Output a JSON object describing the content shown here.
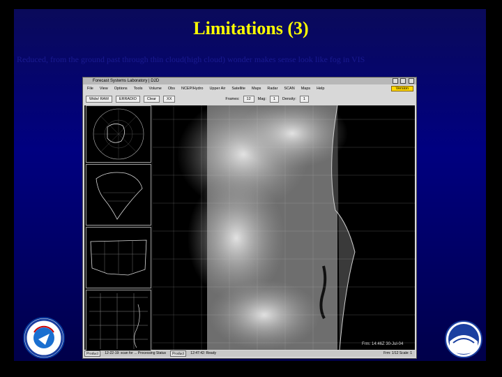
{
  "slide": {
    "title": "Limitations (3)",
    "subtitle": "Reduced, from the ground past through thin cloud(high cloud) wonder makes sense look like fog in VIS",
    "colors": {
      "background": "#000080",
      "title": "#ffff00"
    }
  },
  "app": {
    "window_title": "Forecast Systems Laboratory | D2D",
    "menu": [
      "File",
      "View",
      "Options",
      "Tools",
      "Volume",
      "Obs",
      "NCEP/Hydro",
      "Upper Air",
      "Satellite",
      "Maps",
      "Radar",
      "SCAN",
      "Maps",
      "Help"
    ],
    "version_label": "Version",
    "toolbar": {
      "map_select": "Wide/ RAM",
      "mode_select": "ERRADIO",
      "clear_label": "Clear",
      "frame_value": "XX",
      "frames_label": "Frames:",
      "frames_value": "12",
      "mag_label": "Mag:",
      "mag_value": "1",
      "density_label": "Density:",
      "density_value": "1"
    },
    "main_timestamp": "Frm: 14:46Z 30-Jul-04",
    "status": {
      "left_btn": "Product",
      "left_text": "12-22-19: scan for ... Processing Status",
      "mid_btn": "Product",
      "mid_text": "12:47:42: Ready",
      "right_text": "Frm: 1/12 Scale: 1"
    }
  },
  "logos": {
    "left": "NATIONAL WEATHER SERVICE",
    "right": "NOAA"
  }
}
